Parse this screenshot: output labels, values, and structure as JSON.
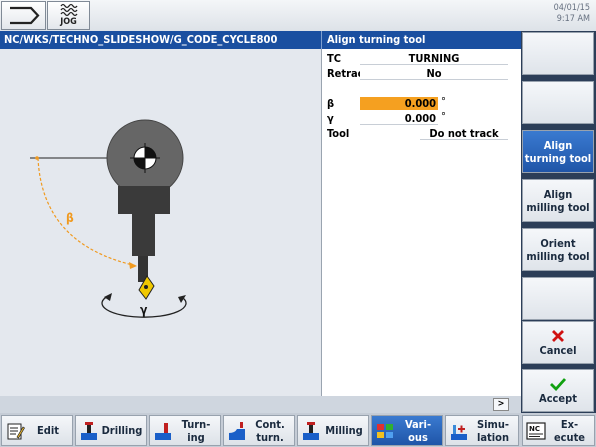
{
  "header": {
    "mode_label": "JOG",
    "date": "04/01/15",
    "time": "9:17 AM"
  },
  "path": "NC/WKS/TECHNO_SLIDESHOW/G_CODE_CYCLE800",
  "form_title": "Align turning tool",
  "graphic": {
    "beta_label": "β",
    "gamma_label": "γ"
  },
  "form": {
    "tc_label": "TC",
    "tc_value": "TURNING",
    "retract_label": "Retract",
    "retract_value": "No",
    "beta_label": "β",
    "beta_value": "0.000",
    "beta_unit": "°",
    "gamma_label": "γ",
    "gamma_value": "0.000",
    "gamma_unit": "°",
    "tool_label": "Tool",
    "tool_value": "Do not track"
  },
  "vertical_softkeys": {
    "align_turning_l1": "Align",
    "align_turning_l2": "turning tool",
    "align_milling_l1": "Align",
    "align_milling_l2": "milling tool",
    "orient_milling_l1": "Orient",
    "orient_milling_l2": "milling tool",
    "cancel": "Cancel",
    "accept": "Accept"
  },
  "horizontal_softkeys": {
    "edit": "Edit",
    "drilling": "Drilling",
    "turning_l1": "Turn-",
    "turning_l2": "ing",
    "cont_turn_l1": "Cont.",
    "cont_turn_l2": "turn.",
    "milling": "Milling",
    "various_l1": "Vari-",
    "various_l2": "ous",
    "simulation_l1": "Simu-",
    "simulation_l2": "lation",
    "execute_l1": "Ex-",
    "execute_l2": "ecute",
    "expand": ">"
  },
  "colors": {
    "title_bar": "#1a4fa0",
    "active_key": "#1f55a8",
    "input_highlight": "#f5a020",
    "tool_insert": "#f0c800",
    "angle_arc": "#f09a20"
  }
}
